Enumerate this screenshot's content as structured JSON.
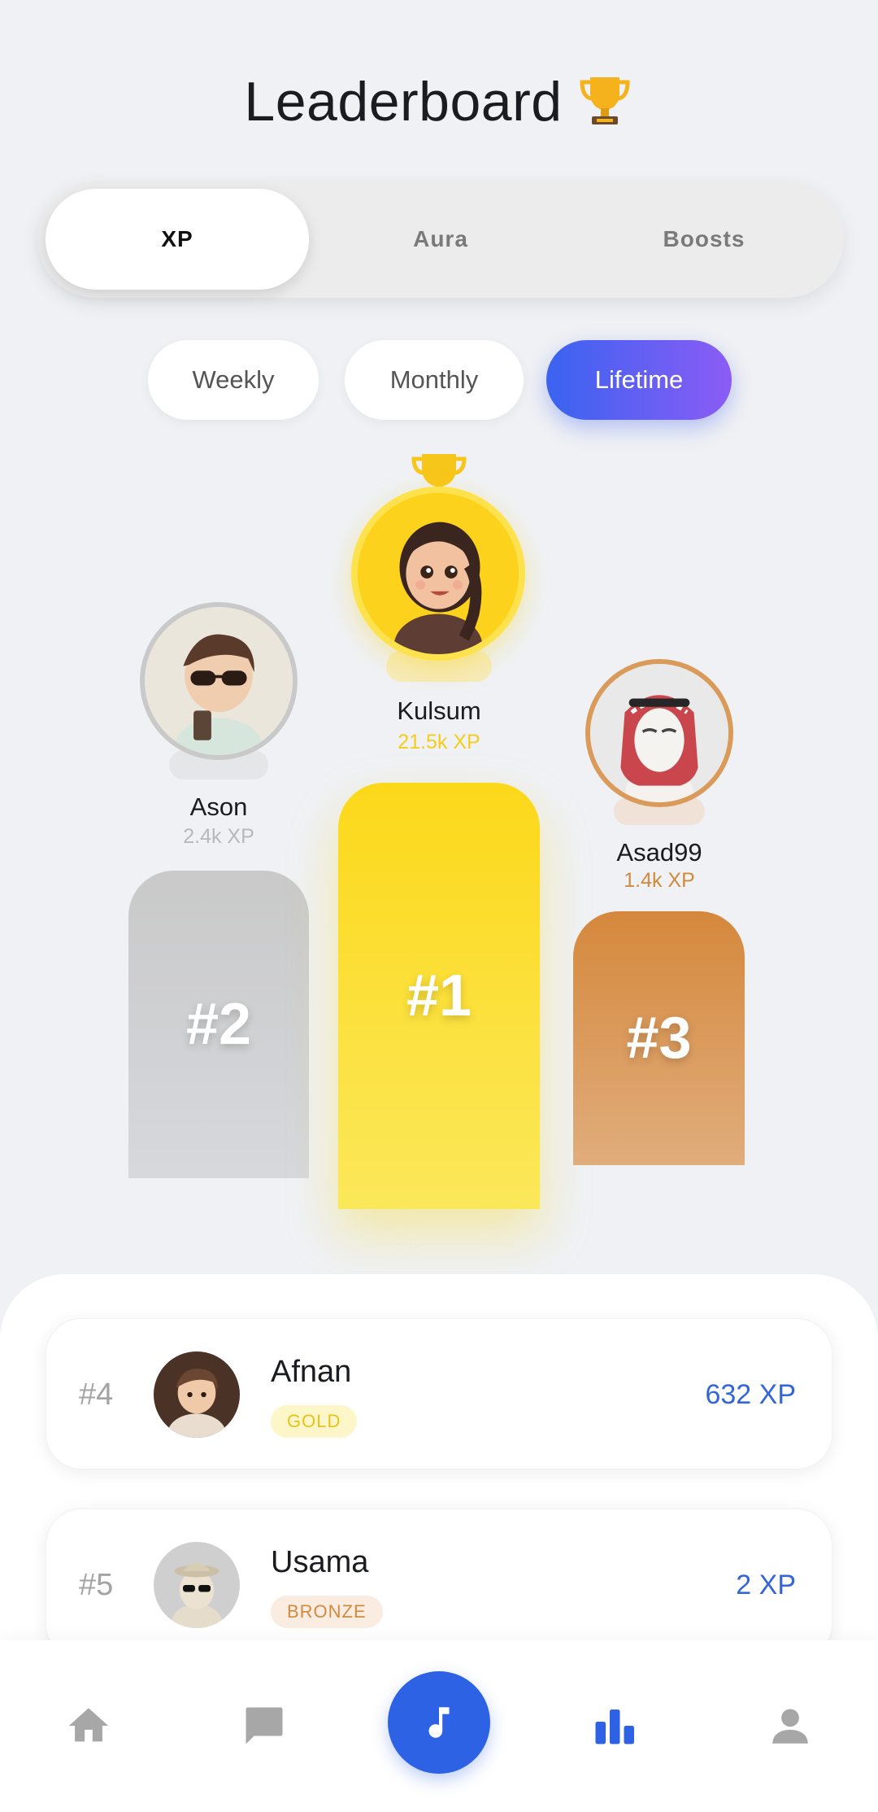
{
  "header": {
    "title": "Leaderboard",
    "title_icon": "trophy-emoji"
  },
  "category_tabs": [
    {
      "label": "XP",
      "active": true
    },
    {
      "label": "Aura",
      "active": false
    },
    {
      "label": "Boosts",
      "active": false
    }
  ],
  "period_pills": [
    {
      "label": "Weekly",
      "active": false
    },
    {
      "label": "Monthly",
      "active": false
    },
    {
      "label": "Lifetime",
      "active": true
    }
  ],
  "podium": {
    "first": {
      "name": "Kulsum",
      "xp": "21.5k XP",
      "rank": "#1",
      "color": "#fcd81a"
    },
    "second": {
      "name": "Ason",
      "xp": "2.4k XP",
      "rank": "#2",
      "color": "#c9c9c9"
    },
    "third": {
      "name": "Asad99",
      "xp": "1.4k XP",
      "rank": "#3",
      "color": "#d5883c"
    }
  },
  "list": [
    {
      "rank": "#4",
      "name": "Afnan",
      "badge": "GOLD",
      "xp": "632 XP"
    },
    {
      "rank": "#5",
      "name": "Usama",
      "badge": "BRONZE",
      "xp": "2 XP"
    }
  ],
  "bottom_nav": [
    "home-icon",
    "chat-icon",
    "music-note-icon",
    "bar-chart-icon",
    "profile-icon"
  ],
  "colors": {
    "accent_blue": "#2e62e5",
    "pill_gradient_start": "#3a63f0",
    "pill_gradient_end": "#8b5cf5",
    "gold": "#fcd81a",
    "bronze": "#d5883c",
    "silver": "#c9c9c9"
  }
}
